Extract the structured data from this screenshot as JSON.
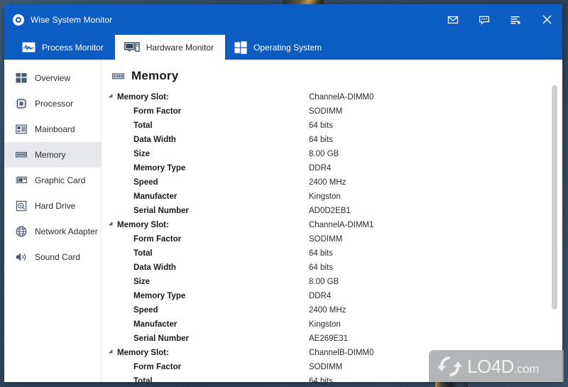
{
  "window": {
    "title": "Wise System Monitor",
    "logo_icon": "app-logo-icon"
  },
  "titlebar_buttons": [
    {
      "name": "mail-icon",
      "label": "Mail"
    },
    {
      "name": "feedback-icon",
      "label": "Feedback"
    },
    {
      "name": "menu-icon",
      "label": "Menu"
    },
    {
      "name": "close-icon",
      "label": "Close"
    }
  ],
  "tabs": [
    {
      "label": "Process Monitor",
      "icon": "process-monitor-icon",
      "active": false
    },
    {
      "label": "Hardware Monitor",
      "icon": "hardware-monitor-icon",
      "active": true
    },
    {
      "label": "Operating System",
      "icon": "operating-system-icon",
      "active": false
    }
  ],
  "sidebar": {
    "items": [
      {
        "label": "Overview",
        "icon": "overview-icon",
        "active": false
      },
      {
        "label": "Processor",
        "icon": "processor-icon",
        "active": false
      },
      {
        "label": "Mainboard",
        "icon": "mainboard-icon",
        "active": false
      },
      {
        "label": "Memory",
        "icon": "memory-icon",
        "active": true
      },
      {
        "label": "Graphic Card",
        "icon": "graphic-card-icon",
        "active": false
      },
      {
        "label": "Hard Drive",
        "icon": "hard-drive-icon",
        "active": false
      },
      {
        "label": "Network Adapter",
        "icon": "network-adapter-icon",
        "active": false
      },
      {
        "label": "Sound Card",
        "icon": "sound-card-icon",
        "active": false
      }
    ]
  },
  "content": {
    "title": "Memory",
    "title_icon": "memory-icon",
    "rows": [
      {
        "type": "group",
        "key": "Memory Slot:",
        "value": "ChannelA-DIMM0"
      },
      {
        "type": "child",
        "key": "Form Factor",
        "value": "SODIMM"
      },
      {
        "type": "child",
        "key": "Total",
        "value": "64 bits"
      },
      {
        "type": "child",
        "key": "Data Width",
        "value": "64 bits"
      },
      {
        "type": "child",
        "key": "Size",
        "value": "8.00 GB"
      },
      {
        "type": "child",
        "key": "Memory Type",
        "value": "DDR4"
      },
      {
        "type": "child",
        "key": "Speed",
        "value": "2400 MHz"
      },
      {
        "type": "child",
        "key": "Manufacter",
        "value": "Kingston"
      },
      {
        "type": "child",
        "key": "Serial Number",
        "value": "AD0D2EB1"
      },
      {
        "type": "group",
        "key": "Memory Slot:",
        "value": "ChannelA-DIMM1"
      },
      {
        "type": "child",
        "key": "Form Factor",
        "value": "SODIMM"
      },
      {
        "type": "child",
        "key": "Total",
        "value": "64 bits"
      },
      {
        "type": "child",
        "key": "Data Width",
        "value": "64 bits"
      },
      {
        "type": "child",
        "key": "Size",
        "value": "8.00 GB"
      },
      {
        "type": "child",
        "key": "Memory Type",
        "value": "DDR4"
      },
      {
        "type": "child",
        "key": "Speed",
        "value": "2400 MHz"
      },
      {
        "type": "child",
        "key": "Manufacter",
        "value": "Kingston"
      },
      {
        "type": "child",
        "key": "Serial Number",
        "value": "AE269E31"
      },
      {
        "type": "group",
        "key": "Memory Slot:",
        "value": "ChannelB-DIMM0"
      },
      {
        "type": "child",
        "key": "Form Factor",
        "value": "SODIMM"
      },
      {
        "type": "child",
        "key": "Total",
        "value": "64 bits"
      }
    ]
  },
  "watermark": {
    "text": "LO4D",
    "suffix": ".com"
  },
  "colors": {
    "header_blue": "#0c5cc2",
    "sidebar_active": "#e7e8ec",
    "scrollbar": "#cfcfcf"
  }
}
